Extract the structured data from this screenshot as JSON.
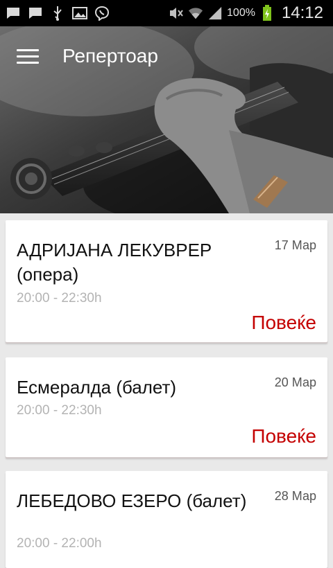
{
  "status_bar": {
    "icons_left": [
      "message-icon",
      "message-icon",
      "usb-icon",
      "image-icon",
      "viber-icon"
    ],
    "icons_right": [
      "mute-icon",
      "wifi-icon",
      "signal-icon",
      "battery-icon"
    ],
    "battery": "100%",
    "time": "14:12"
  },
  "header": {
    "title": "Репертоар",
    "menu_icon": "hamburger-icon"
  },
  "colors": {
    "accent": "#c40000",
    "card_bg": "#ffffff",
    "page_bg": "#e9e9e9"
  },
  "events": [
    {
      "title": "АДРИЈАНА ЛЕКУВРЕР (опера)",
      "date": "17 Мар",
      "time": "20:00 - 22:30h",
      "more": "Повеќе"
    },
    {
      "title": "Есмералда (балет)",
      "date": "20 Мар",
      "time": "20:00 - 22:30h",
      "more": "Повеќе"
    },
    {
      "title": "ЛЕБЕДОВО ЕЗЕРО (балет)",
      "date": "28 Мар",
      "time": "20:00 - 22:00h",
      "more": ""
    }
  ]
}
